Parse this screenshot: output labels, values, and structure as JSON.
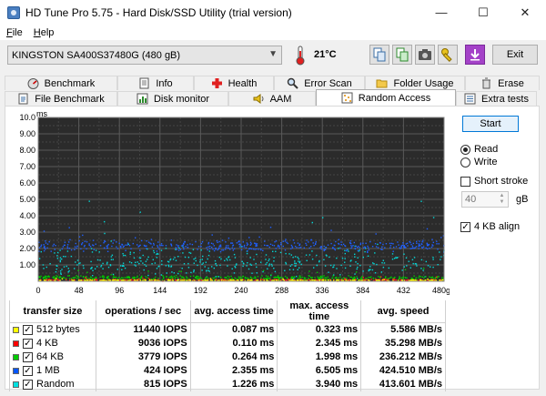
{
  "window": {
    "title": "HD Tune Pro 5.75 - Hard Disk/SSD Utility (trial version)",
    "minimize": "—",
    "maximize": "☐",
    "close": "✕"
  },
  "menu": [
    "File",
    "Help"
  ],
  "toolbar": {
    "drive": "KINGSTON SA400S37480G (480 gB)",
    "temperature": "21°C",
    "exit_label": "Exit"
  },
  "tabs_top": [
    "Benchmark",
    "Info",
    "Health",
    "Error Scan",
    "Folder Usage",
    "Erase"
  ],
  "tabs_bottom": [
    "File Benchmark",
    "Disk monitor",
    "AAM",
    "Random Access",
    "Extra tests"
  ],
  "active_tab": "Random Access",
  "controls": {
    "start_label": "Start",
    "read_label": "Read",
    "write_label": "Write",
    "read_selected": true,
    "short_stroke_label": "Short stroke",
    "short_stroke_checked": false,
    "short_stroke_value": "40",
    "short_stroke_unit": "gB",
    "align_label": "4 KB align",
    "align_checked": true
  },
  "results": {
    "headers": [
      "transfer size",
      "operations / sec",
      "avg. access time",
      "max. access time",
      "avg. speed"
    ],
    "rows": [
      {
        "size": "512 bytes",
        "ops": "11440 IOPS",
        "avg": "0.087 ms",
        "max": "0.323 ms",
        "speed": "5.586 MB/s",
        "color": "#ffff00"
      },
      {
        "size": "4 KB",
        "ops": "9036 IOPS",
        "avg": "0.110 ms",
        "max": "2.345 ms",
        "speed": "35.298 MB/s",
        "color": "#ff0000"
      },
      {
        "size": "64 KB",
        "ops": "3779 IOPS",
        "avg": "0.264 ms",
        "max": "1.998 ms",
        "speed": "236.212 MB/s",
        "color": "#00cc00"
      },
      {
        "size": "1 MB",
        "ops": "424 IOPS",
        "avg": "2.355 ms",
        "max": "6.505 ms",
        "speed": "424.510 MB/s",
        "color": "#0055ff"
      },
      {
        "size": "Random",
        "ops": "815 IOPS",
        "avg": "1.226 ms",
        "max": "3.940 ms",
        "speed": "413.601 MB/s",
        "color": "#00e0e0"
      }
    ]
  },
  "chart_data": {
    "type": "scatter",
    "ylabel": "ms",
    "ylim": [
      0,
      10
    ],
    "yticks": [
      "10.0",
      "9.00",
      "8.00",
      "7.00",
      "6.00",
      "5.00",
      "4.00",
      "3.00",
      "2.00",
      "1.00"
    ],
    "xlim": [
      0,
      480
    ],
    "xticks": [
      "0",
      "48",
      "96",
      "144",
      "192",
      "240",
      "288",
      "336",
      "384",
      "432",
      "480gB"
    ],
    "grid": true,
    "series": [
      {
        "name": "512 bytes",
        "color": "#ffff00",
        "y_center": 0.09,
        "y_spread": 0.05,
        "count": 300
      },
      {
        "name": "4 KB",
        "color": "#ff2020",
        "y_center": 0.11,
        "y_spread": 0.08,
        "count": 300
      },
      {
        "name": "64 KB",
        "color": "#00cc00",
        "y_center": 0.26,
        "y_spread": 0.18,
        "count": 400
      },
      {
        "name": "1 MB",
        "color": "#2060ff",
        "y_center": 2.2,
        "y_spread": 0.5,
        "count": 450
      },
      {
        "name": "Random",
        "color": "#00d8d8",
        "y_center": 1.2,
        "y_spread": 1.4,
        "count": 400
      }
    ]
  }
}
